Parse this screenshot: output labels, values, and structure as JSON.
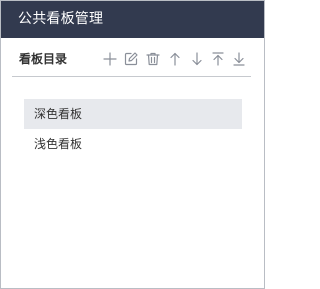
{
  "window": {
    "title": "公共看板管理"
  },
  "toolbar": {
    "title": "看板目录",
    "actions": [
      {
        "name": "add",
        "icon": "plus-icon"
      },
      {
        "name": "edit",
        "icon": "edit-icon"
      },
      {
        "name": "delete",
        "icon": "trash-icon"
      },
      {
        "name": "move-up",
        "icon": "arrow-up-icon"
      },
      {
        "name": "move-down",
        "icon": "arrow-down-icon"
      },
      {
        "name": "move-to-top",
        "icon": "arrow-to-top-icon"
      },
      {
        "name": "move-to-bottom",
        "icon": "arrow-to-bottom-icon"
      }
    ]
  },
  "boards": [
    {
      "label": "深色看板",
      "selected": true
    },
    {
      "label": "浅色看板",
      "selected": false
    }
  ],
  "colors": {
    "titlebar_bg": "#323a4f",
    "selected_row": "#e7e9ed",
    "icon": "#8a8f99"
  }
}
